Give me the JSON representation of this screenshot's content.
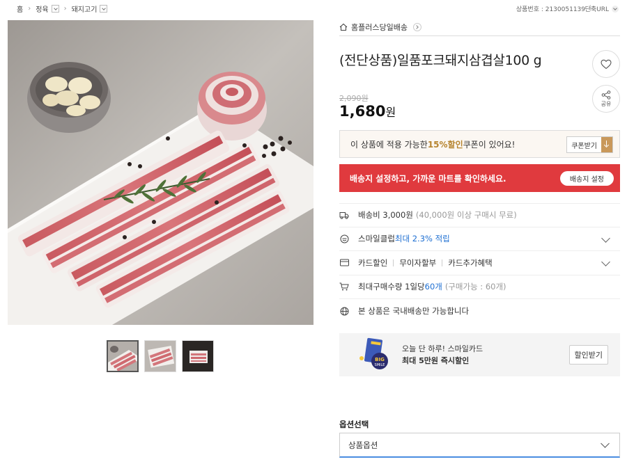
{
  "breadcrumb": {
    "items": [
      "홈",
      "정육",
      "돼지고기"
    ]
  },
  "header": {
    "product_number": "상품번호 : 2130051139",
    "short_url": "단축URL"
  },
  "product": {
    "store_name": "홈플러스당일배송",
    "title": "(전단상품)일품포크돼지삼겹살100 g",
    "original_price": "2,090원",
    "price": "1,680",
    "price_unit": "원",
    "share_label": "공유"
  },
  "coupon": {
    "text_before": "이 상품에 적용 가능한 ",
    "highlight": "15%할인",
    "text_after": " 쿠폰이 있어요!",
    "button_label": "쿠폰받기"
  },
  "delivery_notice": {
    "text": "배송지 설정하고, 가까운 마트를 확인하세요.",
    "button_label": "배송지 설정"
  },
  "info": {
    "shipping": {
      "label": "배송비 3,000원",
      "note": "(40,000원 이상 구매시 무료)"
    },
    "smileclub": {
      "label": "스마일클럽 ",
      "highlight": "최대 2.3% 적립"
    },
    "card": {
      "items": [
        "카드할인",
        "무이자할부",
        "카드추가혜택"
      ]
    },
    "max_purchase": {
      "label": "최대구매수량 1일당 ",
      "highlight": "60개",
      "note": "(구매가능 : 60개)"
    },
    "domestic": {
      "label": "본 상품은 국내배송만 가능합니다"
    }
  },
  "card_banner": {
    "line1": "오늘 단 하루! 스마일카드",
    "line2": "최대 5만원 즉시할인",
    "button_label": "할인받기",
    "badge": "BIG SMILE"
  },
  "options": {
    "label": "옵션선택",
    "select_value": "상품옵션"
  },
  "colors": {
    "accent_red": "#e03a3e",
    "coupon_gold": "#b6842f",
    "link_blue": "#1e6fd2"
  }
}
